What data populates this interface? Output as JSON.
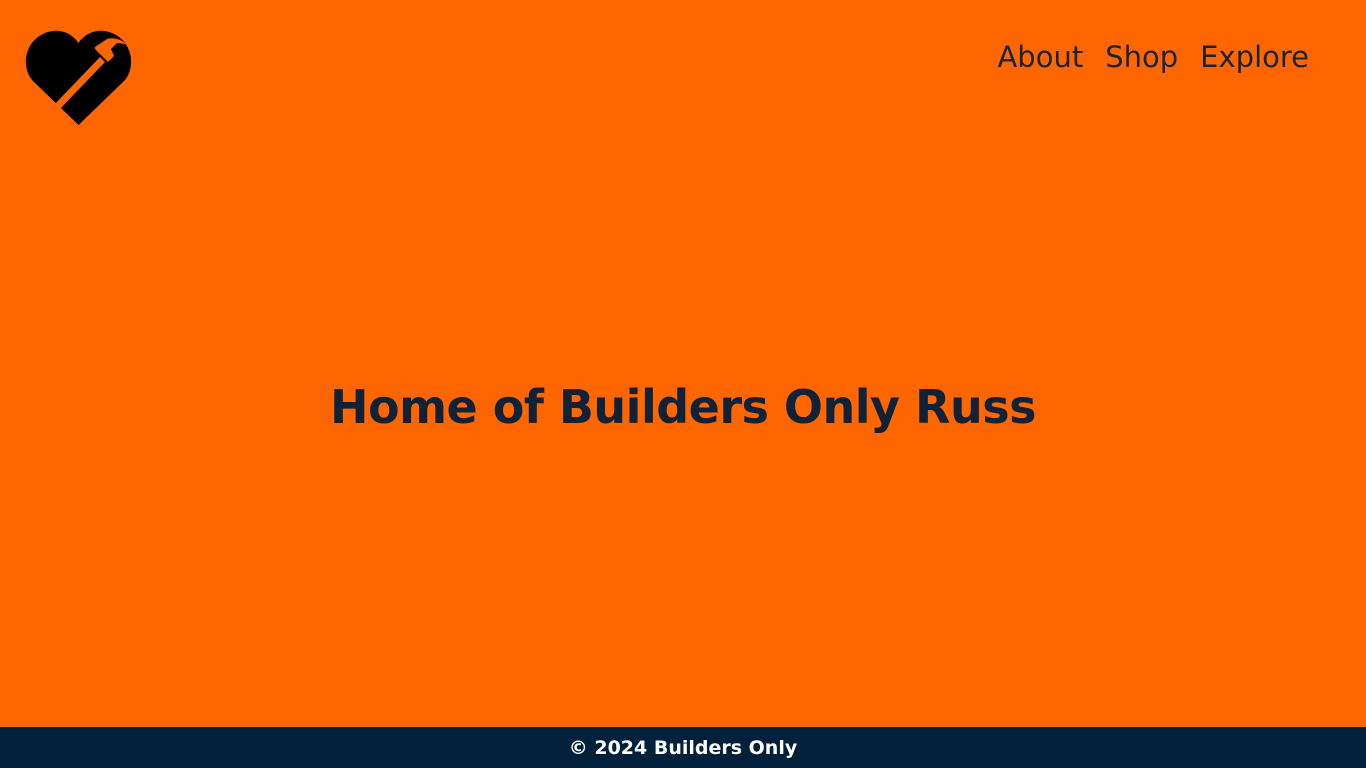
{
  "brand": {
    "logo_icon": "heart-hammer-icon",
    "logo_color": "#000000"
  },
  "nav": {
    "items": [
      {
        "label": "About"
      },
      {
        "label": "Shop"
      },
      {
        "label": "Explore"
      }
    ]
  },
  "hero": {
    "title": "Home of Builders Only Russ"
  },
  "footer": {
    "text": "© 2024 Builders Only"
  },
  "colors": {
    "page_background": "#ff6600",
    "footer_background": "#00203b",
    "heading_text": "#0f2238",
    "nav_text": "#1c2333",
    "footer_text": "#ffffff"
  }
}
